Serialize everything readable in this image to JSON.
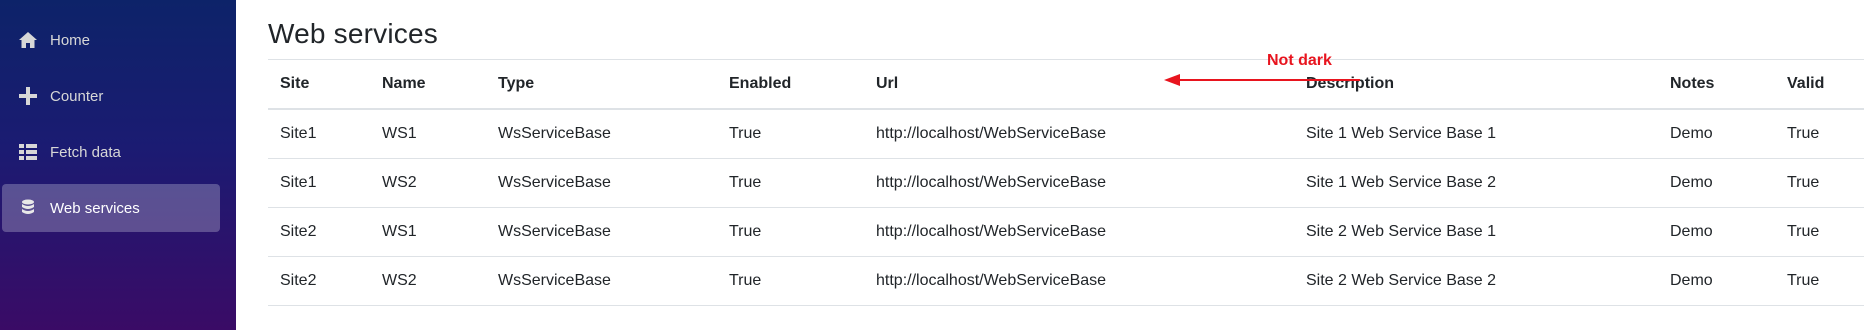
{
  "sidebar": {
    "items": [
      {
        "label": "Home",
        "icon": "home-icon",
        "active": false
      },
      {
        "label": "Counter",
        "icon": "plus-icon",
        "active": false
      },
      {
        "label": "Fetch data",
        "icon": "list-icon",
        "active": false
      },
      {
        "label": "Web services",
        "icon": "database-icon",
        "active": true
      }
    ]
  },
  "main": {
    "title": "Web services",
    "table": {
      "headers": [
        "Site",
        "Name",
        "Type",
        "Enabled",
        "Url",
        "Description",
        "Notes",
        "Valid"
      ],
      "rows": [
        [
          "Site1",
          "WS1",
          "WsServiceBase",
          "True",
          "http://localhost/WebServiceBase",
          "Site 1 Web Service Base 1",
          "Demo",
          "True"
        ],
        [
          "Site1",
          "WS2",
          "WsServiceBase",
          "True",
          "http://localhost/WebServiceBase",
          "Site 1 Web Service Base 2",
          "Demo",
          "True"
        ],
        [
          "Site2",
          "WS1",
          "WsServiceBase",
          "True",
          "http://localhost/WebServiceBase",
          "Site 2 Web Service Base 1",
          "Demo",
          "True"
        ],
        [
          "Site2",
          "WS2",
          "WsServiceBase",
          "True",
          "http://localhost/WebServiceBase",
          "Site 2 Web Service Base 2",
          "Demo",
          "True"
        ]
      ]
    }
  },
  "annotation": {
    "text": "Not dark",
    "color": "#e8141e"
  },
  "colors": {
    "sidebar_top": "#0d2369",
    "sidebar_bottom": "#3a0b66",
    "active_item_bg": "rgba(255,255,255,0.25)"
  }
}
